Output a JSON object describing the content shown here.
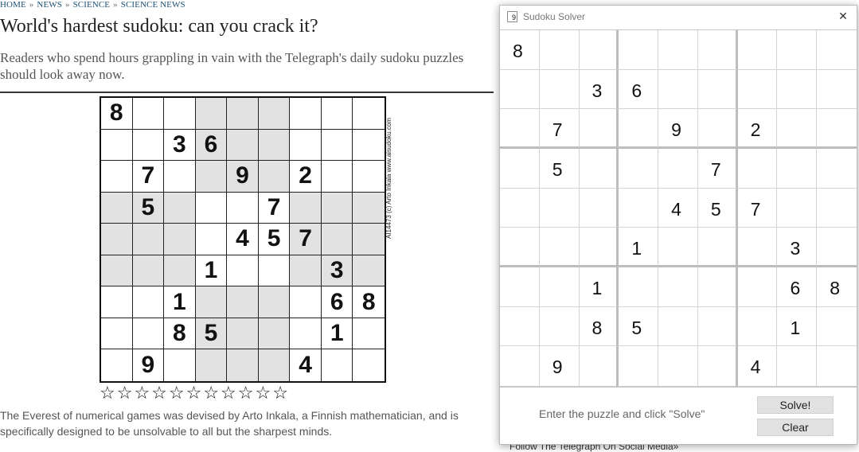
{
  "breadcrumb": [
    {
      "label": "HOME"
    },
    {
      "label": "NEWS"
    },
    {
      "label": "SCIENCE"
    },
    {
      "label": "SCIENCE NEWS"
    }
  ],
  "breadcrumb_sep": "»",
  "article": {
    "headline": "World's hardest sudoku: can you crack it?",
    "standfirst": "Readers who spend hours grappling in vain with the Telegraph's daily sudoku puzzles should look away now.",
    "image_credit": "AI14473 (c) Arto Inkala www.aisudoku.com",
    "rating_stars": "☆☆☆☆☆☆☆☆☆☆☆",
    "caption": "The Everest of numerical games was devised by Arto Inkala, a Finnish mathematician, and is specifically designed to be unsolvable to all but the sharpest minds.",
    "follow_link": "Follow The Telegraph On Social Media»"
  },
  "puzzle": [
    [
      "8",
      "",
      "",
      "",
      "",
      "",
      "",
      "",
      ""
    ],
    [
      "",
      "",
      "3",
      "6",
      "",
      "",
      "",
      "",
      ""
    ],
    [
      "",
      "7",
      "",
      "",
      "9",
      "",
      "2",
      "",
      ""
    ],
    [
      "",
      "5",
      "",
      "",
      "",
      "7",
      "",
      "",
      ""
    ],
    [
      "",
      "",
      "",
      "",
      "4",
      "5",
      "7",
      "",
      ""
    ],
    [
      "",
      "",
      "",
      "1",
      "",
      "",
      "",
      "3",
      ""
    ],
    [
      "",
      "",
      "1",
      "",
      "",
      "",
      "",
      "6",
      "8"
    ],
    [
      "",
      "",
      "8",
      "5",
      "",
      "",
      "",
      "1",
      ""
    ],
    [
      "",
      "9",
      "",
      "",
      "",
      "",
      "4",
      "",
      ""
    ]
  ],
  "solver": {
    "title": "Sudoku Solver",
    "icon_glyph": "9",
    "close_glyph": "✕",
    "hint": "Enter the puzzle and click \"Solve\"",
    "solve_label": "Solve!",
    "clear_label": "Clear"
  }
}
